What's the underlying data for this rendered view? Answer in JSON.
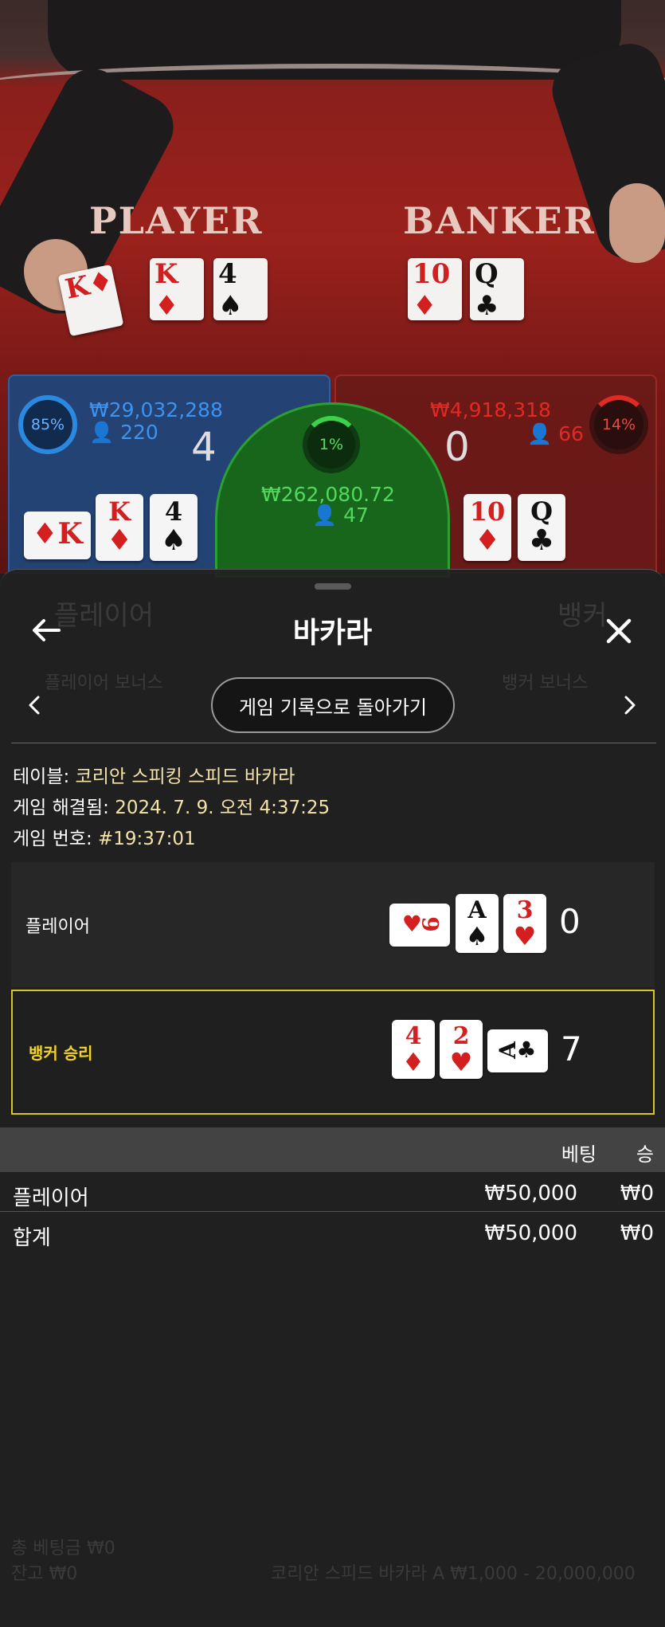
{
  "scene": {
    "felt_player": "PLAYER",
    "felt_banker": "BANKER",
    "player_cards": [
      {
        "rank": "K",
        "suit": "♦",
        "color": "red"
      },
      {
        "rank": "K",
        "suit": "♦",
        "color": "red"
      },
      {
        "rank": "4",
        "suit": "♠",
        "color": "black"
      }
    ],
    "banker_cards": [
      {
        "rank": "10",
        "suit": "♦",
        "color": "red"
      },
      {
        "rank": "Q",
        "suit": "♣",
        "color": "black"
      }
    ]
  },
  "bet_stats": {
    "player": {
      "percent": "85%",
      "amount": "₩29,032,288",
      "count": "220",
      "score": "4"
    },
    "tie": {
      "percent": "1%",
      "amount": "₩262,080.72",
      "count": "47"
    },
    "banker": {
      "percent": "14%",
      "amount": "₩4,918,318",
      "count": "66",
      "score": "0"
    }
  },
  "sheet": {
    "title": "바카라",
    "back_link": "게임 기록으로 돌아가기",
    "info": {
      "table_label": "테이블:",
      "table_value": "코리안 스피킹 스피드 바카라",
      "resolved_label": "게임 해결됨:",
      "resolved_value": "2024. 7. 9. 오전 4:37:25",
      "game_label": "게임 번호:",
      "game_value": "#19:37:01"
    },
    "result_rows": [
      {
        "label": "플레이어",
        "score": "0",
        "cards": [
          {
            "rank": "9",
            "suit": "♥",
            "color": "red",
            "side": true
          },
          {
            "rank": "A",
            "suit": "♠",
            "color": "black",
            "side": false
          },
          {
            "rank": "3",
            "suit": "♥",
            "color": "red",
            "side": false
          }
        ]
      },
      {
        "label": "뱅커 승리",
        "score": "7",
        "cards": [
          {
            "rank": "4",
            "suit": "♦",
            "color": "red",
            "side": false
          },
          {
            "rank": "2",
            "suit": "♥",
            "color": "red",
            "side": false
          },
          {
            "rank": "A",
            "suit": "♣",
            "color": "black",
            "side": true
          }
        ]
      }
    ],
    "bets_table": {
      "headers": [
        "베팅",
        "승"
      ],
      "rows": [
        {
          "name": "플레이어",
          "bet": "₩50,000",
          "win": "₩0"
        },
        {
          "name": "합계",
          "bet": "₩50,000",
          "win": "₩0"
        }
      ]
    }
  },
  "background_ui": {
    "tabs": [
      "플레이어",
      "뱅커"
    ],
    "bonus": [
      "플레이어 보너스",
      "뱅커 보너스"
    ],
    "bottom_left_1": "총 베팅금 ₩0",
    "bottom_left_2": "잔고 ₩0",
    "bottom_right": "코리안 스피드 바카라 A ₩1,000 - 20,000,000"
  }
}
